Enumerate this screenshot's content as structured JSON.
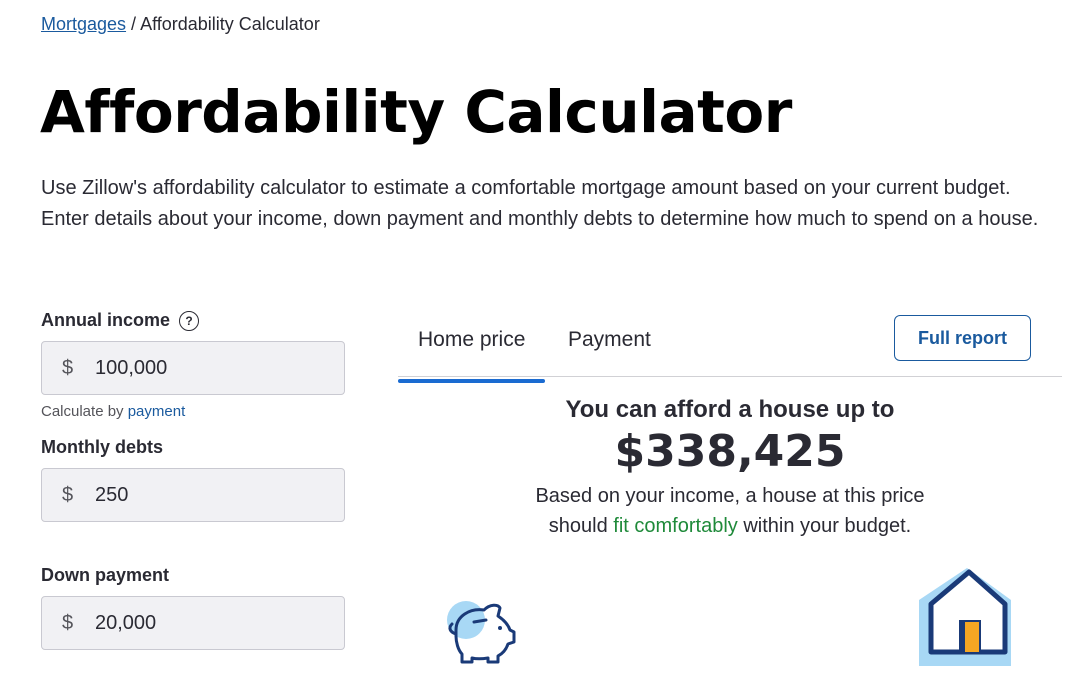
{
  "breadcrumb": {
    "link": "Mortgages",
    "separator": " / ",
    "current": "Affordability Calculator"
  },
  "title": "Affordability Calculator",
  "intro": "Use Zillow's affordability calculator to estimate a comfortable mortgage amount based on your current budget. Enter details about your income, down payment and monthly debts to determine how much to spend on a house.",
  "form": {
    "annual_income": {
      "label": "Annual income",
      "help_icon": "?",
      "prefix": "$",
      "value": "100,000"
    },
    "calc_by": {
      "text": "Calculate by ",
      "link": "payment"
    },
    "monthly_debts": {
      "label": "Monthly debts",
      "prefix": "$",
      "value": "250"
    },
    "down_payment": {
      "label": "Down payment",
      "prefix": "$",
      "value": "20,000"
    }
  },
  "tabs": [
    {
      "label": "Home price",
      "active": true
    },
    {
      "label": "Payment",
      "active": false
    }
  ],
  "full_report": "Full report",
  "result": {
    "headline": "You can afford a house up to",
    "amount": "$338,425",
    "desc_line1": "Based on your income, a house at this price",
    "desc_prefix": "should ",
    "desc_highlight": "fit comfortably",
    "desc_suffix": " within your budget."
  },
  "colors": {
    "accent": "#1a6bd1",
    "link": "#1a5a9e",
    "success": "#1f8a3a",
    "input_bg": "#f1f1f4"
  },
  "icons": {
    "piggy": "piggy-bank-icon",
    "house": "house-icon"
  }
}
